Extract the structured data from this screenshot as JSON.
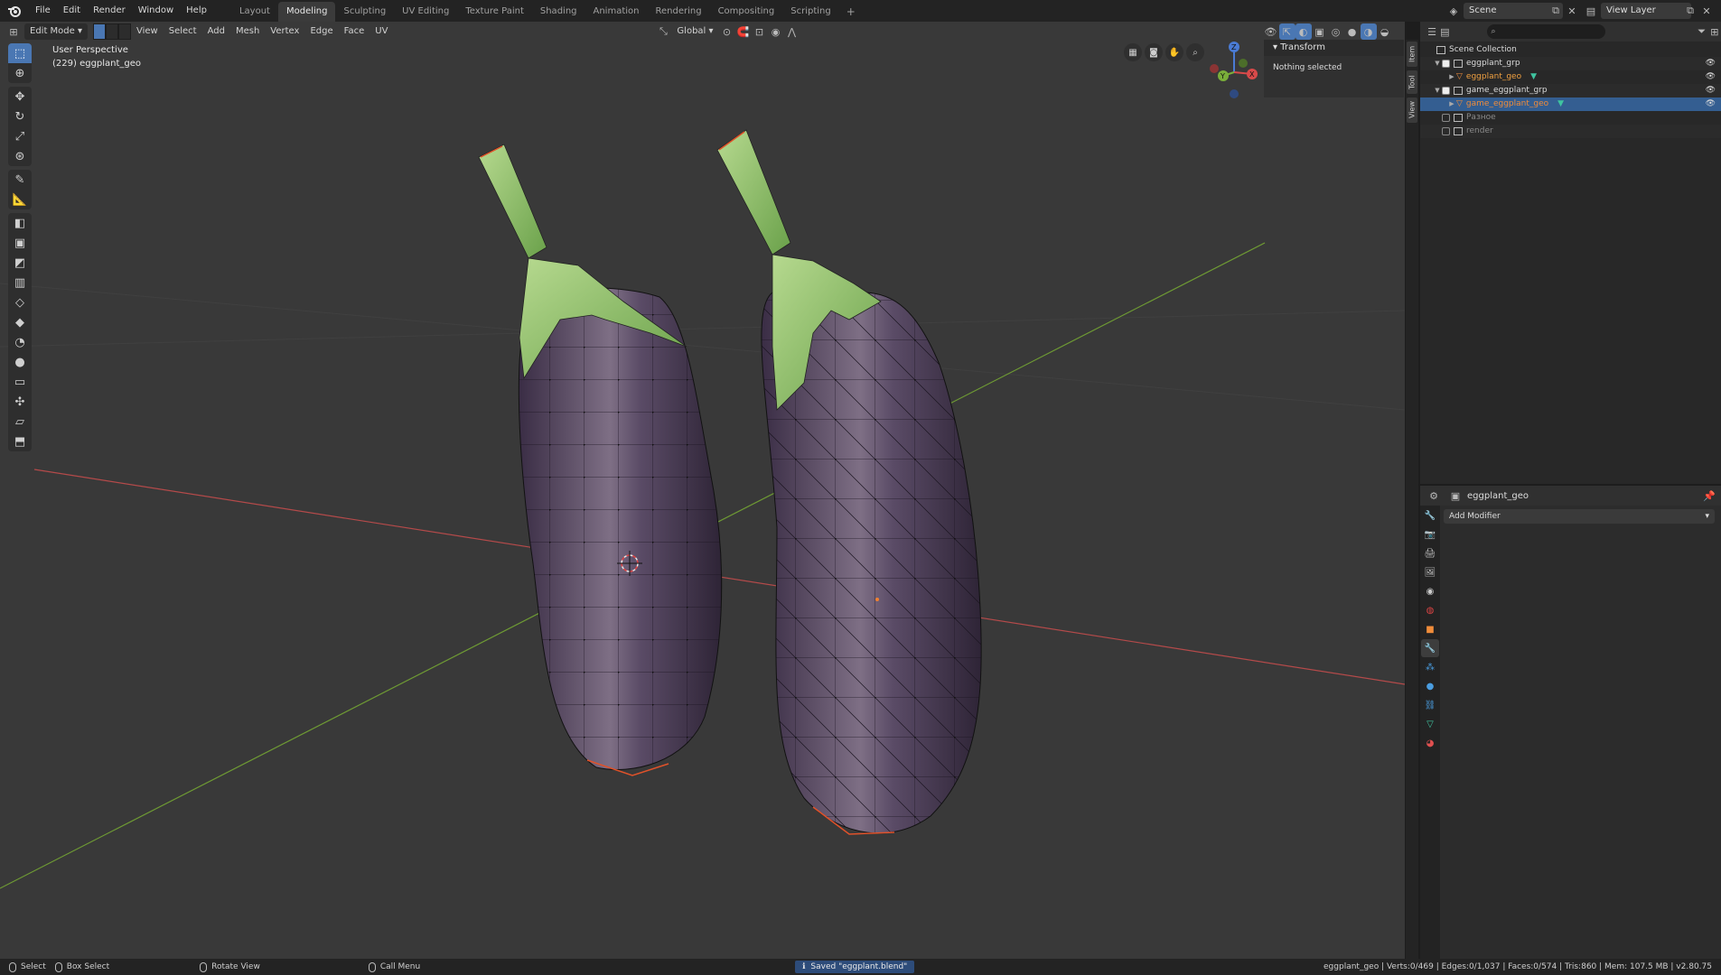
{
  "topbar": {
    "menus": [
      "File",
      "Edit",
      "Render",
      "Window",
      "Help"
    ],
    "workspaces": [
      "Layout",
      "Modeling",
      "Sculpting",
      "UV Editing",
      "Texture Paint",
      "Shading",
      "Animation",
      "Rendering",
      "Compositing",
      "Scripting"
    ],
    "active_workspace": "Modeling",
    "add_label": "+",
    "scene": "Scene",
    "view_layer": "View Layer"
  },
  "viewport": {
    "mode": "Edit Mode",
    "menus": [
      "View",
      "Select",
      "Add",
      "Mesh",
      "Vertex",
      "Edge",
      "Face",
      "UV"
    ],
    "orientation": "Global",
    "perspective_label": "User Perspective",
    "object_label": "(229) eggplant_geo",
    "gizmo": {
      "z": "Z",
      "y": "Y",
      "x": "X"
    }
  },
  "npanel": {
    "header": "Transform",
    "message": "Nothing selected",
    "tabs": [
      "Item",
      "Tool",
      "View"
    ]
  },
  "outliner": {
    "root": "Scene Collection",
    "items": [
      {
        "label": "eggplant_grp",
        "type": "collection"
      },
      {
        "label": "eggplant_geo",
        "type": "mesh"
      },
      {
        "label": "game_eggplant_grp",
        "type": "collection"
      },
      {
        "label": "game_eggplant_geo",
        "type": "mesh"
      },
      {
        "label": "Разное",
        "type": "collection"
      },
      {
        "label": "render",
        "type": "collection"
      }
    ]
  },
  "properties": {
    "object_name": "eggplant_geo",
    "add_modifier": "Add Modifier"
  },
  "statusbar": {
    "select": "Select",
    "box_select": "Box Select",
    "rotate_view": "Rotate View",
    "call_menu": "Call Menu",
    "message": "Saved \"eggplant.blend\"",
    "stats": "eggplant_geo | Verts:0/469 | Edges:0/1,037 | Faces:0/574 | Tris:860 | Mem: 107.5 MB | v2.80.75"
  },
  "colors": {
    "accent": "#4a77b3",
    "selection": "#345e91",
    "eggplant_body": "#5b4a66",
    "stem": "#8fc46a",
    "axis_x": "#c94a4a",
    "axis_y": "#7aa33a"
  }
}
